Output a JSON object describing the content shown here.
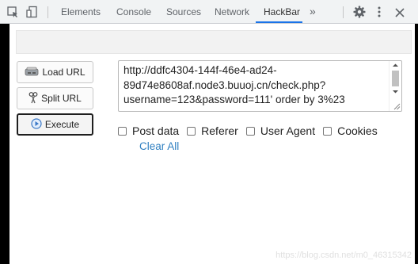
{
  "devtools": {
    "tabs": [
      {
        "label": "Elements"
      },
      {
        "label": "Console"
      },
      {
        "label": "Sources"
      },
      {
        "label": "Network"
      },
      {
        "label": "HackBar"
      }
    ],
    "more_tabs_label": "»",
    "active_tab": "HackBar",
    "accent_color": "#1a73e8",
    "icons": [
      "inspect-element-icon",
      "device-toolbar-icon",
      "settings-gear-icon",
      "more-menu-icon",
      "close-icon"
    ]
  },
  "hackbar": {
    "buttons": {
      "load_url": "Load URL",
      "split_url": "Split URL",
      "execute": "Execute"
    },
    "url_lines": [
      "http://ddfc4304-144f-46e4-ad24-",
      "89d74e8608af.node3.buuoj.cn/check.php?",
      "username=123&password=111' order by 3%23"
    ],
    "options": {
      "post_data": "Post data",
      "referer": "Referer",
      "user_agent": "User Agent",
      "cookies": "Cookies"
    },
    "clear_all": "Clear All"
  },
  "watermark": "https://blog.csdn.net/m0_46315342"
}
